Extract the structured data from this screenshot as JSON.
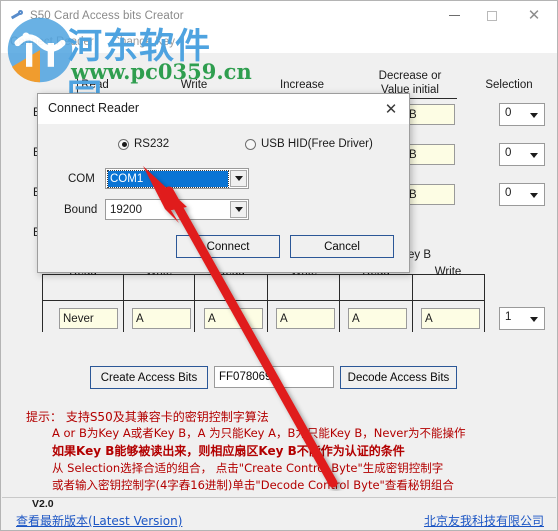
{
  "window": {
    "title": "S50 Card Access bits Creator",
    "icon": "key-icon",
    "controls": {
      "minimize": "—",
      "maximize": "□",
      "close": "✕"
    }
  },
  "menubar": {
    "items": [
      "Connect Reader",
      "Change Key"
    ]
  },
  "watermark": {
    "site_cn": "河东软件园",
    "url": "www.pc0359.cn",
    "logo": "pc0359-logo"
  },
  "grid_top": {
    "headers": [
      "Read",
      "Write",
      "Increase",
      "Decrease or\nValue initial",
      "Selection"
    ],
    "header_read": "Read",
    "header_write": "Write",
    "header_increase": "Increase",
    "header_decrease_l1": "Decrease or",
    "header_decrease_l2": "Value initial",
    "header_selection": "Selection",
    "rows": [
      {
        "label": "B",
        "value": "B",
        "selection": "0"
      },
      {
        "label": "B",
        "value": "B",
        "selection": "0"
      },
      {
        "label": "B",
        "value": "B",
        "selection": "0"
      },
      {
        "label": "B",
        "value": "",
        "selection": ""
      }
    ]
  },
  "grid_bottom": {
    "group_label": "ey B",
    "headers": [
      "Read",
      "Write",
      "Read",
      "Write",
      "Read",
      "Write"
    ],
    "values": [
      "Never",
      "A",
      "A",
      "A",
      "A",
      "A"
    ],
    "selection": "1"
  },
  "actions": {
    "create_label": "Create Access Bits",
    "decode_label": "Decode Access Bits",
    "hex_value": "FF078069"
  },
  "hints": {
    "line1": "提示： 支持S50及其兼容卡的密钥控制字算法",
    "line2": "A or B为Key A或者Key B，A 为只能Key A，B为只能Key B，Never为不能操作",
    "line3": "如果Key B能够被读出来，则相应扇区Key B不能作为认证的条件",
    "line4": "从 Selection选择合适的组合， 点击\"Create Control Byte\"生成密钥控制字",
    "line5": "或者输入密钥控制字(4字舂16进制)单击\"Decode Control Byte\"查看秘钥组合"
  },
  "statusbar": {
    "version": "V2.0",
    "latest_link": "查看最新版本(Latest Version)",
    "company_link": "北京友我科技有限公司"
  },
  "dialog": {
    "title": "Connect Reader",
    "close_glyph": "✕",
    "radio_rs232": {
      "label": "RS232",
      "selected": true
    },
    "radio_usbhid": {
      "label": "USB HID(Free Driver)",
      "selected": false
    },
    "com_label": "COM",
    "com_value": "COM1",
    "bound_label": "Bound",
    "bound_value": "19200",
    "connect_label": "Connect",
    "cancel_label": "Cancel"
  },
  "colors": {
    "accent_blue": "#0a74d4",
    "button_border": "#2b5797",
    "field_yellow": "#fdfde4",
    "hint_red": "#b30000",
    "link_blue": "#1b55c4",
    "arrow_red": "#e01b1b",
    "watermark_blue": "#4ea3e0",
    "watermark_green": "#2f9e4f"
  }
}
